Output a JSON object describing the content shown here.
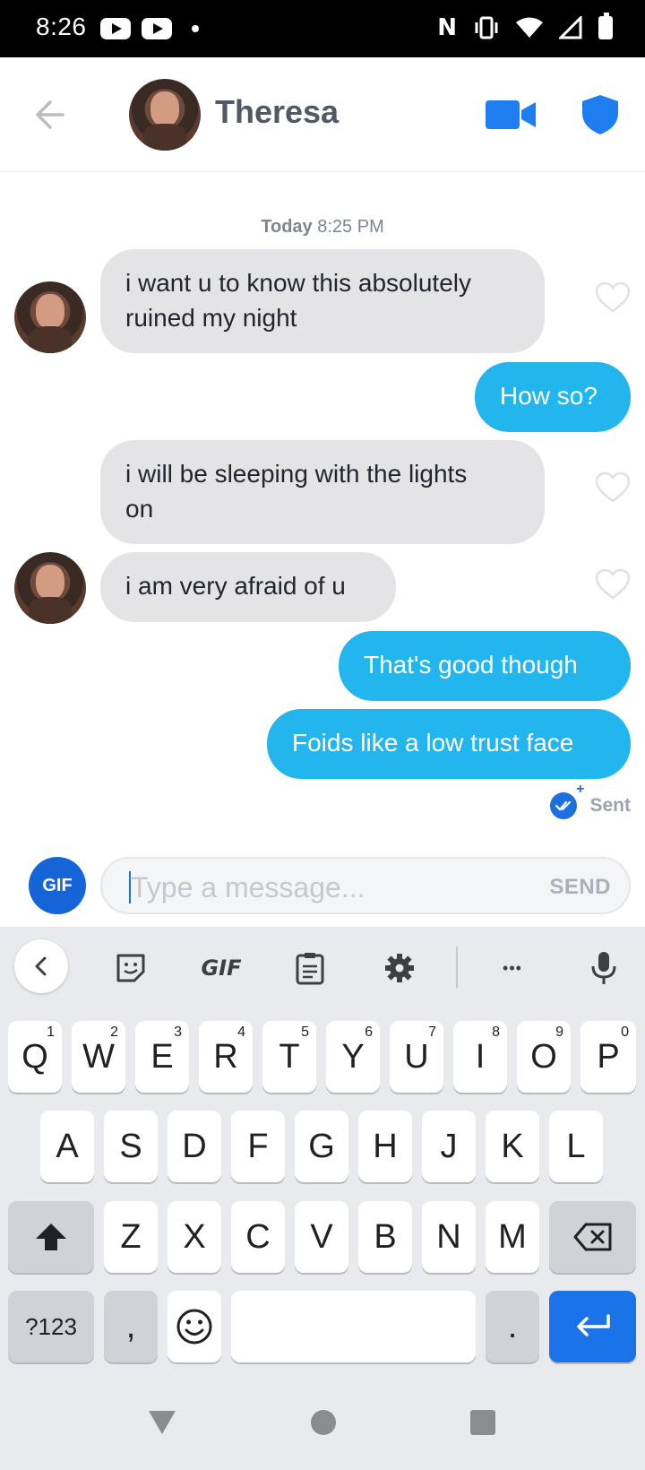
{
  "status_bar": {
    "time": "8:26",
    "nfc": "N"
  },
  "header": {
    "contact_name": "Theresa"
  },
  "conversation": {
    "timestamp_day": "Today",
    "timestamp_time": "8:25 PM",
    "messages": [
      {
        "text_line1": "i want u to know this absolutely",
        "text_line2": "ruined my night"
      },
      {
        "text": "How so?"
      },
      {
        "text_line1": "i will be sleeping with the lights",
        "text_line2": "on"
      },
      {
        "text": "i am very afraid of u"
      },
      {
        "text": "That's good though"
      },
      {
        "text": "Foids like a low trust face"
      }
    ],
    "sent_label": "Sent"
  },
  "composer": {
    "gif_label": "GIF",
    "placeholder": "Type a message...",
    "send_label": "SEND"
  },
  "keyboard": {
    "toolbar_gif": "GIF",
    "toolbar_more": "•••",
    "row1": [
      {
        "key": "Q",
        "hint": "1"
      },
      {
        "key": "W",
        "hint": "2"
      },
      {
        "key": "E",
        "hint": "3"
      },
      {
        "key": "R",
        "hint": "4"
      },
      {
        "key": "T",
        "hint": "5"
      },
      {
        "key": "Y",
        "hint": "6"
      },
      {
        "key": "U",
        "hint": "7"
      },
      {
        "key": "I",
        "hint": "8"
      },
      {
        "key": "O",
        "hint": "9"
      },
      {
        "key": "P",
        "hint": "0"
      }
    ],
    "row2": [
      "A",
      "S",
      "D",
      "F",
      "G",
      "H",
      "J",
      "K",
      "L"
    ],
    "row3": [
      "Z",
      "X",
      "C",
      "V",
      "B",
      "N",
      "M"
    ],
    "symbols_label": "?123",
    "comma": ",",
    "period": "."
  },
  "colors": {
    "accent_blue": "#23b6ee",
    "brand_blue": "#1565d8",
    "incoming_bubble": "#e4e4e6"
  }
}
